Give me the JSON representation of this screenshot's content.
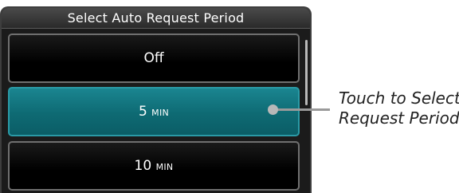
{
  "dialog": {
    "title": "Select Auto Request Period",
    "options": [
      {
        "value": "Off",
        "unit": ""
      },
      {
        "value": "5",
        "unit": "MIN"
      },
      {
        "value": "10",
        "unit": "MIN"
      }
    ],
    "selected_index": 1,
    "colors": {
      "selected": "#0e6a73",
      "background": "#000000"
    }
  },
  "callout": {
    "line1": "Touch to Select",
    "line2": "Request Period",
    "pointer_icon": "touch-point-indicator"
  }
}
